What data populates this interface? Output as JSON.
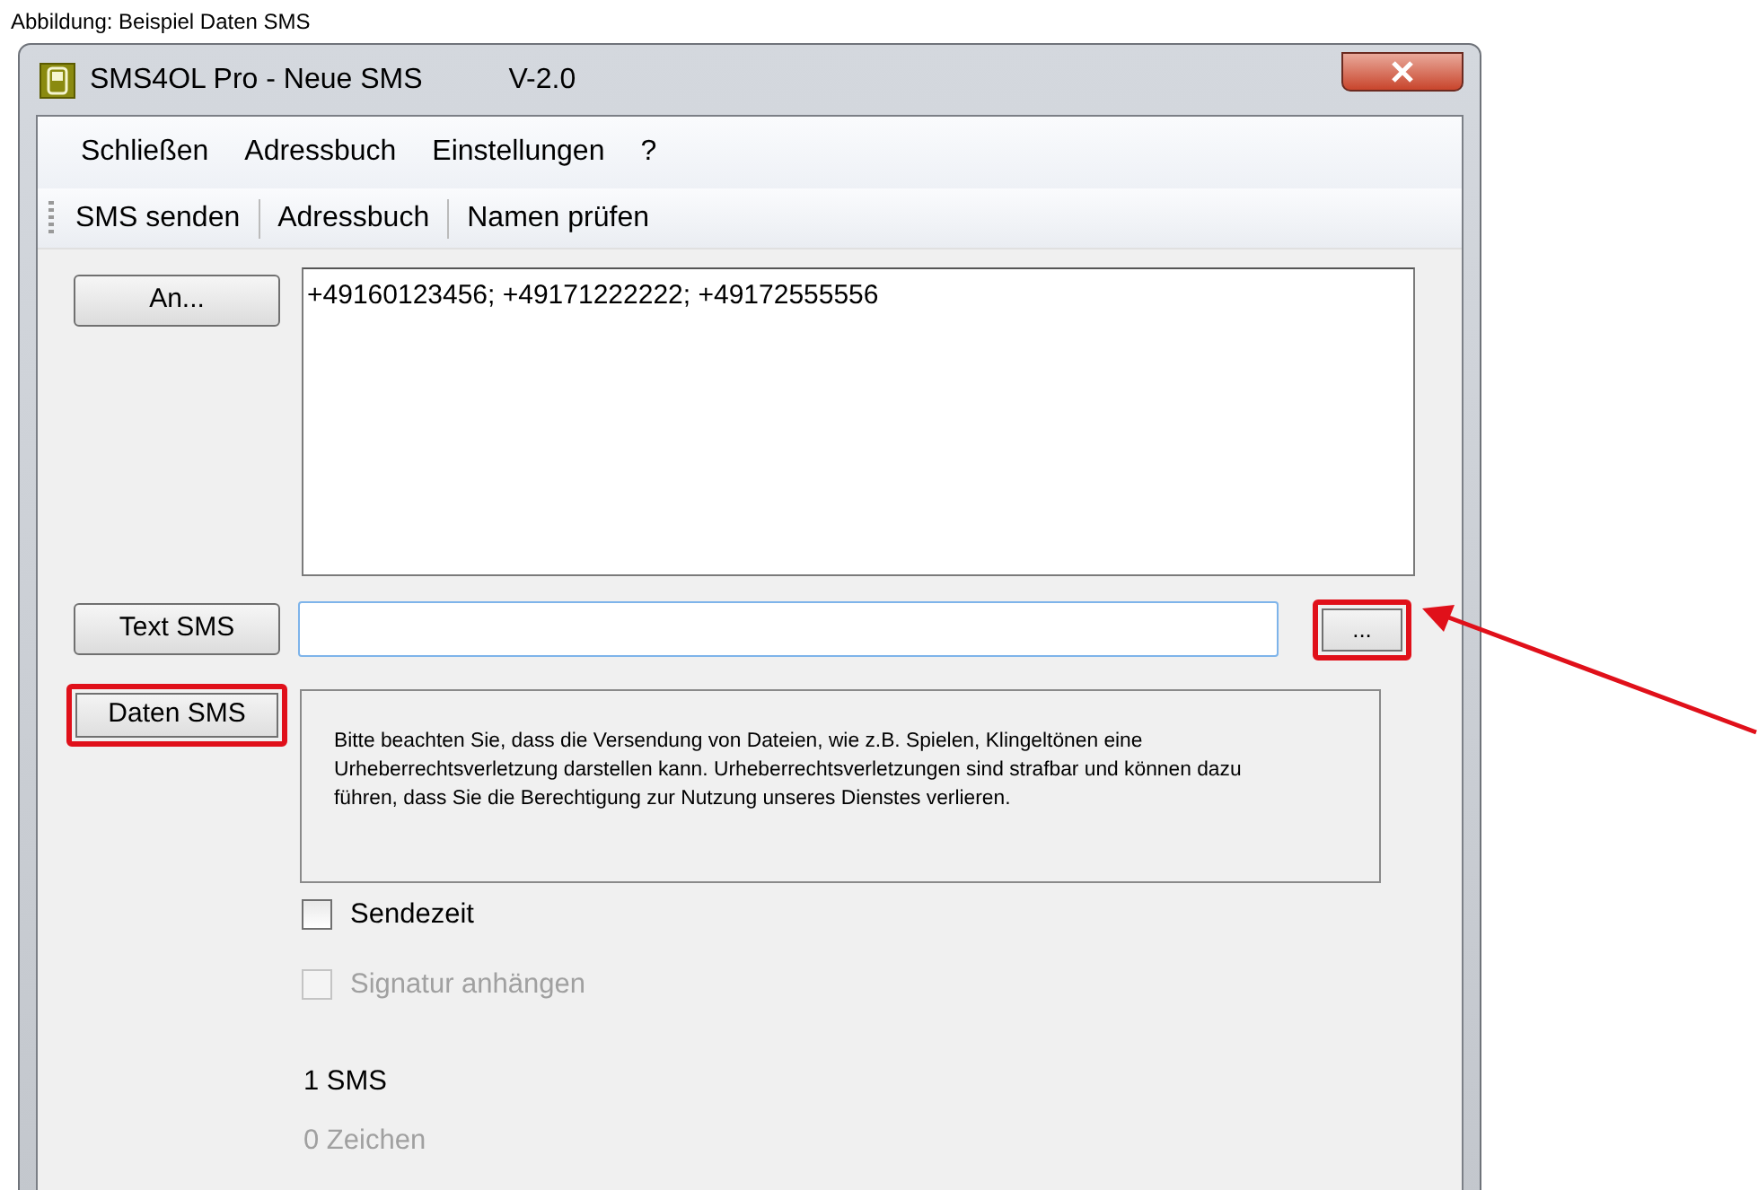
{
  "caption": "Abbildung: Beispiel Daten SMS",
  "window": {
    "title": "SMS4OL Pro - Neue SMS",
    "version": "V-2.0"
  },
  "menu": [
    "Schließen",
    "Adressbuch",
    "Einstellungen",
    "?"
  ],
  "toolbar": [
    "SMS senden",
    "Adressbuch",
    "Namen prüfen"
  ],
  "recipients": {
    "button": {
      "label": "An...",
      "highlighted": false
    },
    "value": "+49160123456; +49171222222; +49172555556"
  },
  "text_sms": {
    "button": {
      "label": "Text SMS",
      "highlighted": false
    },
    "browse": {
      "label": "...",
      "highlighted": true
    }
  },
  "data_sms": {
    "button": {
      "label": "Daten SMS",
      "highlighted": true
    },
    "notice": "Bitte beachten Sie, dass die Versendung von Dateien, wie z.B. Spielen, Klingeltönen eine Urheberrechtsverletzung darstellen kann. Urheberrechtsverletzungen sind strafbar und können dazu führen, dass Sie die Berechtigung zur Nutzung unseres Dienstes verlieren."
  },
  "options": [
    {
      "label": "Sendezeit",
      "checked": false,
      "disabled": false
    },
    {
      "label": "Signatur anhängen",
      "checked": false,
      "disabled": true
    }
  ],
  "sms_count": "1 SMS",
  "char_count": "0 Zeichen",
  "annotation_arrow": true
}
